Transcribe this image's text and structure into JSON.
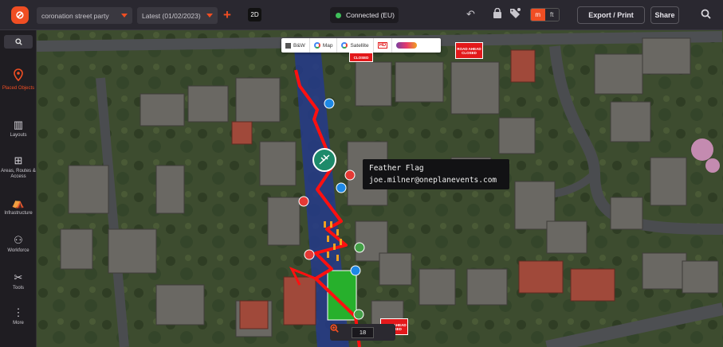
{
  "topbar": {
    "event_name": "coronation street party",
    "version": "Latest (01/02/2023)",
    "view_mode": "2D",
    "connection_status": "Connected (EU)",
    "unit_metric": "m",
    "unit_imperial": "ft",
    "export_label": "Export / Print",
    "share_label": "Share",
    "accent_color": "#f04e23"
  },
  "sidebar": {
    "items": [
      {
        "label": "Placed Objects",
        "icon": "map-pin-icon",
        "active": true
      },
      {
        "label": "Layouts",
        "icon": "bars-icon"
      },
      {
        "label": "Areas, Routes & Access",
        "icon": "route-icon"
      },
      {
        "label": "Infrastructure",
        "icon": "tent-icon"
      },
      {
        "label": "Workforce",
        "icon": "people-icon"
      },
      {
        "label": "Tools",
        "icon": "tools-icon"
      },
      {
        "label": "More",
        "icon": "more-icon"
      }
    ]
  },
  "map": {
    "layers": {
      "bw": "B&W",
      "map": "Map",
      "satellite": "Satellite",
      "hd": "HD"
    },
    "signs": {
      "closed": "CLOSED",
      "road_ahead_closed": "ROAD AHEAD CLOSED"
    },
    "tooltip": {
      "title": "Feather Flag",
      "user": "joe.milner@oneplanevents.com"
    },
    "zoom_level": "18"
  }
}
